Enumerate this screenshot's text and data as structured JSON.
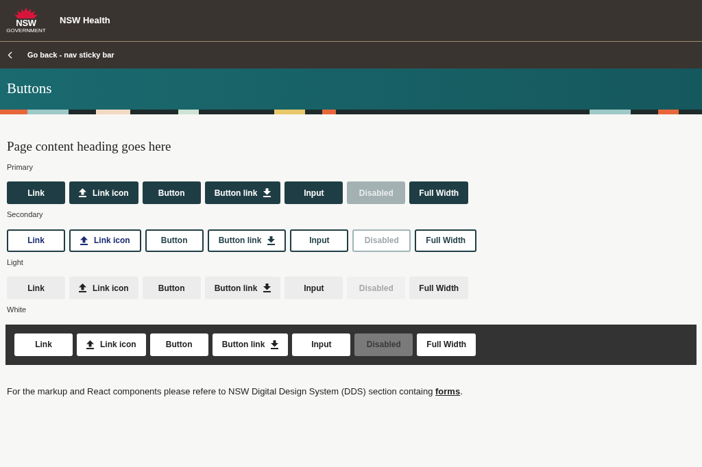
{
  "header": {
    "logo_text": "NSW",
    "logo_subtext": "GOVERNMENT",
    "title": "NSW Health"
  },
  "nav": {
    "back_label": "Go back - nav sticky bar"
  },
  "banner": {
    "title": "Buttons"
  },
  "heading": "Page content heading goes here",
  "groups": [
    {
      "label": "Primary",
      "kind": "primary",
      "buttons": [
        {
          "label": "Link",
          "kind": "link",
          "disabled": false
        },
        {
          "label": "Link icon",
          "kind": "uploadlink",
          "disabled": false
        },
        {
          "label": "Button",
          "kind": "button",
          "disabled": false
        },
        {
          "label": "Button link",
          "kind": "downloadbutton",
          "disabled": false
        },
        {
          "label": "Input",
          "kind": "input",
          "disabled": false
        },
        {
          "label": "Disabled",
          "kind": "button",
          "disabled": true
        },
        {
          "label": "Full Width",
          "kind": "button",
          "disabled": false
        }
      ]
    },
    {
      "label": "Secondary",
      "kind": "secondary",
      "buttons": [
        {
          "label": "Link",
          "kind": "link",
          "disabled": false
        },
        {
          "label": "Link icon",
          "kind": "uploadlink",
          "disabled": false
        },
        {
          "label": "Button",
          "kind": "button",
          "disabled": false
        },
        {
          "label": "Button link",
          "kind": "downloadbutton",
          "disabled": false
        },
        {
          "label": "Input",
          "kind": "input",
          "disabled": false
        },
        {
          "label": "Disabled",
          "kind": "button",
          "disabled": true
        },
        {
          "label": "Full Width",
          "kind": "button",
          "disabled": false
        }
      ]
    },
    {
      "label": "Light",
      "kind": "light",
      "buttons": [
        {
          "label": "Link",
          "kind": "link",
          "disabled": false
        },
        {
          "label": "Link icon",
          "kind": "uploadlink",
          "disabled": false
        },
        {
          "label": "Button",
          "kind": "button",
          "disabled": false
        },
        {
          "label": "Button link",
          "kind": "downloadbutton",
          "disabled": false
        },
        {
          "label": "Input",
          "kind": "input",
          "disabled": false
        },
        {
          "label": "Disabled",
          "kind": "button",
          "disabled": true
        },
        {
          "label": "Full Width",
          "kind": "button",
          "disabled": false
        }
      ]
    },
    {
      "label": "White",
      "kind": "white",
      "buttons": [
        {
          "label": "Link",
          "kind": "link",
          "disabled": false
        },
        {
          "label": "Link icon",
          "kind": "uploadlink",
          "disabled": false
        },
        {
          "label": "Button",
          "kind": "button",
          "disabled": false
        },
        {
          "label": "Button link",
          "kind": "downloadbutton",
          "disabled": false
        },
        {
          "label": "Input",
          "kind": "input",
          "disabled": false
        },
        {
          "label": "Disabled",
          "kind": "button",
          "disabled": true
        },
        {
          "label": "Full Width",
          "kind": "button",
          "disabled": false
        }
      ]
    }
  ],
  "note": {
    "text": "For the markup and React components please refere to NSW Digital Design System (DDS) section containg ",
    "link": "forms",
    "after": "."
  }
}
